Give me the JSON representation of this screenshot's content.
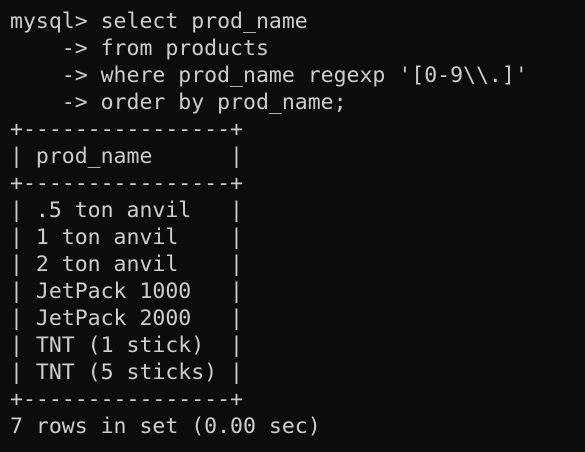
{
  "terminal": {
    "lines": [
      "mysql> select prod_name",
      "    -> from products",
      "    -> where prod_name regexp '[0-9\\\\.]'",
      "    -> order by prod_name;",
      "+----------------+",
      "| prod_name      |",
      "+----------------+",
      "| .5 ton anvil   |",
      "| 1 ton anvil    |",
      "| 2 ton anvil    |",
      "| JetPack 1000   |",
      "| JetPack 2000   |",
      "| TNT (1 stick)  |",
      "| TNT (5 sticks) |",
      "+----------------+",
      "7 rows in set (0.00 sec)"
    ]
  },
  "colors": {
    "background": "#0c0c0c",
    "text": "#cccccc"
  }
}
